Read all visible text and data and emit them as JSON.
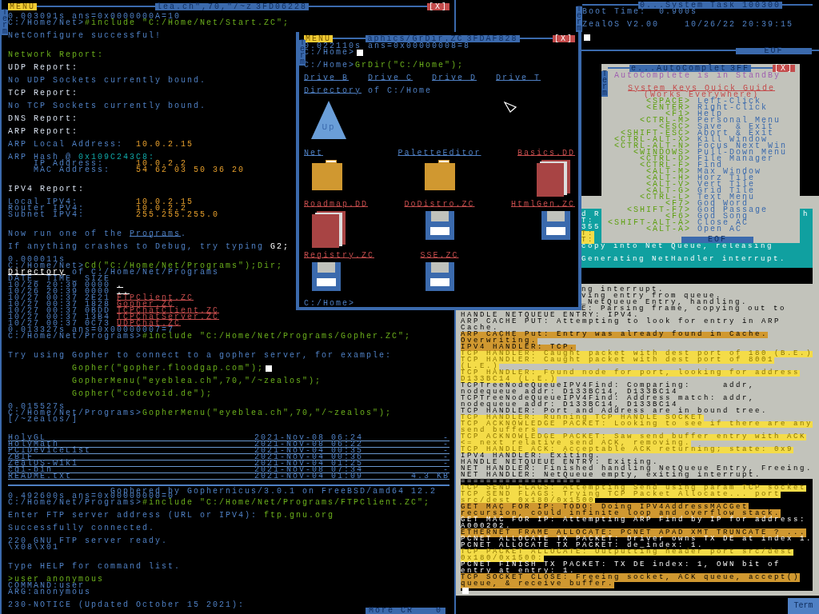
{
  "main_window": {
    "menu": "MENU",
    "title": "lea.ch\",70,\"/~z",
    "task_id": "3FD06228",
    "close": "[X]",
    "side_tab": "Term",
    "lines": [
      {
        "segments": [
          {
            "kind": "out",
            "text": "0.003091s ans=0x0000000A=10"
          }
        ]
      },
      {
        "segments": [
          {
            "kind": "out",
            "text": "C:/Home/Net>"
          },
          {
            "kind": "cmd",
            "text": "#include \"C:/Home/Net/Start.ZC\";"
          }
        ]
      },
      {
        "segments": [
          {
            "kind": "out",
            "text": "NetConfigure successful!"
          }
        ]
      },
      {
        "segments": [
          {
            "kind": "cmd",
            "text": "Network Report:"
          }
        ]
      },
      {
        "segments": [
          {
            "kind": "head",
            "text": "UDP Report:"
          }
        ]
      },
      {
        "segments": [
          {
            "kind": "out",
            "text": "No UDP Sockets currently bound."
          }
        ]
      },
      {
        "segments": [
          {
            "kind": "head",
            "text": "TCP Report:"
          }
        ]
      },
      {
        "segments": [
          {
            "kind": "out",
            "text": "No TCP Sockets currently bound."
          }
        ]
      },
      {
        "segments": [
          {
            "kind": "head",
            "text": "DNS Report:"
          }
        ]
      },
      {
        "segments": [
          {
            "kind": "head",
            "text": "ARP Report:"
          }
        ]
      },
      {
        "segments": [
          {
            "kind": "out",
            "text": "ARP Local Address:"
          },
          {
            "kind": "val",
            "text": "10.0.2.15"
          }
        ]
      },
      {
        "segments": [
          {
            "kind": "out",
            "text": "ARP Hash @ "
          },
          {
            "kind": "addr",
            "text": "0x109C243C8:"
          }
        ]
      },
      {
        "segments": [
          {
            "kind": "out",
            "text": "IP Address:"
          },
          {
            "kind": "val",
            "text": "10.0.2.2"
          }
        ]
      },
      {
        "segments": [
          {
            "kind": "out",
            "text": "MAC Address:"
          },
          {
            "kind": "val",
            "text": "54 62 03 50 36 20"
          }
        ]
      },
      {
        "segments": [
          {
            "kind": "head",
            "text": "IPV4 Report:"
          }
        ]
      },
      {
        "segments": [
          {
            "kind": "out",
            "text": "Local IPV4:"
          },
          {
            "kind": "val",
            "text": "10.0.2.15"
          }
        ]
      },
      {
        "segments": [
          {
            "kind": "out",
            "text": "Router IPV4:"
          },
          {
            "kind": "val",
            "text": "10.0.2.2"
          }
        ]
      },
      {
        "segments": [
          {
            "kind": "out",
            "text": "Subnet IPV4:"
          },
          {
            "kind": "val",
            "text": "255.255.255.0"
          }
        ]
      },
      {
        "segments": [
          {
            "kind": "out",
            "text": "Now run one of the "
          },
          {
            "kind": "link",
            "text": "Programs"
          },
          {
            "kind": "out",
            "text": "."
          }
        ]
      },
      {
        "segments": [
          {
            "kind": "out",
            "text": "If anything crashes to Debug, try typing "
          },
          {
            "kind": "hi",
            "text": "G2;"
          }
        ]
      },
      {
        "segments": [
          {
            "kind": "out",
            "text": "0.000011s"
          }
        ]
      },
      {
        "segments": [
          {
            "kind": "out",
            "text": "C:/Home/Net>"
          },
          {
            "kind": "cmd",
            "text": "Cd(\"C:/Home/Net/Programs\");Dir;"
          }
        ]
      },
      {
        "segments": [
          {
            "kind": "dir",
            "text": "Directory"
          },
          {
            "kind": "out",
            "text": " of C:/Home/Net/Programs"
          }
        ]
      },
      {
        "segments": [
          {
            "kind": "out",
            "text": "DATE_ TIME_ SIZE"
          }
        ]
      },
      {
        "segments": [
          {
            "kind": "out",
            "text": "10/26 20:39 0000 "
          },
          {
            "kind": "dir",
            "text": "."
          }
        ]
      },
      {
        "segments": [
          {
            "kind": "out",
            "text": "10/26 20:39 0000 "
          },
          {
            "kind": "dir",
            "text": ".."
          }
        ]
      },
      {
        "segments": [
          {
            "kind": "out",
            "text": "10/27 00:37 2E21 "
          },
          {
            "kind": "file",
            "text": "FTPClient.ZC"
          }
        ]
      },
      {
        "segments": [
          {
            "kind": "out",
            "text": "10/27 00:37 1828 "
          },
          {
            "kind": "file",
            "text": "Gopher.ZC"
          }
        ]
      },
      {
        "segments": [
          {
            "kind": "out",
            "text": "10/27 00:37 0BDD "
          },
          {
            "kind": "file",
            "text": "TCPChatClient.ZC"
          }
        ]
      },
      {
        "segments": [
          {
            "kind": "out",
            "text": "10/27 00:37 13B4 "
          },
          {
            "kind": "file",
            "text": "TCPChatServer.ZC"
          }
        ]
      },
      {
        "segments": [
          {
            "kind": "out",
            "text": "10/27 00:37 0C73 "
          },
          {
            "kind": "file",
            "text": "UDPChat.ZC"
          }
        ]
      },
      {
        "segments": [
          {
            "kind": "out",
            "text": "0.013327s ans=0x00000007=7"
          }
        ]
      },
      {
        "segments": [
          {
            "kind": "out",
            "text": "C:/Home/Net/Programs>"
          },
          {
            "kind": "cmd",
            "text": "#include \"C:/Home/Net/Programs/Gopher.ZC\";"
          }
        ]
      },
      {
        "segments": [
          {
            "kind": "out",
            "text": "Try using Gopher to connect to a gopher server, for example:"
          }
        ]
      },
      {
        "cursor": true,
        "segments": [
          {
            "kind": "cmd",
            "text": "Gopher(\"gopher.floodgap.com\");"
          }
        ]
      },
      {
        "segments": [
          {
            "kind": "cmd",
            "text": "GopherMenu(\"eyeblea.ch\",70,\"/~zealos\");"
          }
        ]
      },
      {
        "segments": [
          {
            "kind": "cmd",
            "text": "Gopher(\"codevoid.de\");"
          }
        ]
      },
      {
        "segments": [
          {
            "kind": "out",
            "text": "0.015527s"
          }
        ]
      },
      {
        "segments": [
          {
            "kind": "out",
            "text": "C:/Home/Net/Programs>"
          },
          {
            "kind": "cmd",
            "text": "GopherMenu(\"eyeblea.ch\",70,\"/~zealos\");"
          }
        ]
      },
      {
        "segments": [
          {
            "kind": "out",
            "text": "[/~zealos/]"
          }
        ]
      }
    ],
    "gopher_listing": {
      "rows": [
        {
          "name": "HolyGL",
          "date": "2021-Nov-08 06:24",
          "size": "-"
        },
        {
          "name": "HolyMath",
          "date": "2021-Nov-08 06:22",
          "size": "-"
        },
        {
          "name": "PCIDeviceList",
          "date": "2021-Nov-04 00:35",
          "size": "-"
        },
        {
          "name": "ZBIF",
          "date": "2021-Nov-04 00:36",
          "size": "-"
        },
        {
          "name": "ZealOS-wiki",
          "date": "2021-Nov-04 01:25",
          "size": "-"
        },
        {
          "name": "cgi-bin",
          "date": "2021-Nov-08 07:34",
          "size": "-"
        },
        {
          "name": "README.txt",
          "date": "2021-Nov-04 01:09",
          "size": "4.3 KB"
        }
      ],
      "footer": "Gophered by Gophernicus/3.0.1 on FreeBSD/amd64 12.2"
    },
    "lines_after": [
      {
        "segments": [
          {
            "kind": "out",
            "text": "0.492600s ans=0x00000000=0"
          }
        ]
      },
      {
        "segments": [
          {
            "kind": "out",
            "text": "C:/Home/Net/Programs>"
          },
          {
            "kind": "cmd",
            "text": "#include \"C:/Home/Net/Programs/FTPClient.ZC\";"
          }
        ]
      },
      {
        "segments": [
          {
            "kind": "out",
            "text": "Enter FTP server address (URL or IPV4): "
          },
          {
            "kind": "cmd",
            "text": "ftp.gnu.org"
          }
        ]
      },
      {
        "segments": [
          {
            "kind": "out",
            "text": "Successfully connected."
          }
        ]
      },
      {
        "segments": [
          {
            "kind": "out",
            "text": "220 GNU FTP server ready."
          }
        ]
      },
      {
        "segments": [
          {
            "kind": "out",
            "text": "\\x08\\x01"
          }
        ]
      },
      {
        "segments": [
          {
            "kind": "out",
            "text": "Type HELP for command list."
          }
        ]
      },
      {
        "segments": [
          {
            "kind": "cmd",
            "text": ">user anonymous"
          }
        ]
      },
      {
        "segments": [
          {
            "kind": "out",
            "text": "COMMAND:user"
          }
        ]
      },
      {
        "segments": [
          {
            "kind": "out",
            "text": "ARG:anonymous"
          }
        ]
      },
      {
        "segments": [
          {
            "kind": "out",
            "text": "230-NOTICE (Updated October 15 2021):"
          }
        ]
      }
    ],
    "status_bar": {
      "label": "More CR",
      "value": "0"
    }
  },
  "grdir_window": {
    "menu": "MENU",
    "title": "aphics/GrDir.ZC",
    "task_id": "3FDAF828",
    "close": "[X]",
    "side_tab": "Term",
    "lines": [
      {
        "segments": [
          {
            "kind": "out",
            "text": "0.022110s ans=0x00000008=8"
          }
        ]
      },
      {
        "cursor": true,
        "segments": [
          {
            "kind": "out",
            "text": "C:/Home>"
          }
        ]
      },
      {
        "segments": [
          {
            "kind": "out",
            "text": "C:/Home>"
          },
          {
            "kind": "cmd",
            "text": "GrDir(\"C:/Home\");"
          }
        ]
      }
    ],
    "drives": [
      "Drive B",
      "Drive C",
      "Drive D",
      "Drive T"
    ],
    "directory": {
      "link": "Directory",
      "path": " of C:/Home"
    },
    "up_label": "Up",
    "items": [
      {
        "kind": "folder",
        "name": "Net"
      },
      {
        "kind": "folder",
        "name": "PaletteEditor"
      },
      {
        "kind": "book",
        "name": "Basics.DD"
      },
      {
        "kind": "book",
        "name": "Roadmap.DD"
      },
      {
        "kind": "file",
        "name": "DoDistro.ZC"
      },
      {
        "kind": "file",
        "name": "HtmlGen.ZC"
      },
      {
        "kind": "file",
        "name": "Registry.ZC"
      },
      {
        "kind": "file",
        "name": "SSE.ZC"
      }
    ],
    "prompt": "C:/Home>"
  },
  "system_task_window": {
    "title": "0...System Task 100300",
    "side_tab": "Term",
    "boot_label": "Boot Time:",
    "boot_value": "0.900s",
    "version": "ZealOS V2.00",
    "date_time": "10/26/22 20:39:15",
    "footer": "EOF"
  },
  "autocomplete_window": {
    "title": "e...AutoComplet",
    "task_id": "3FF",
    "close": "[X]",
    "side_tab": "Term",
    "status": "AutoComplete is in StandBy",
    "heading": "System Keys Quick Guide",
    "subheading": "(Works Everywhere)",
    "keys": [
      {
        "key": "<SPACE>",
        "action": "Left-Click"
      },
      {
        "key": "<ENTER>",
        "action": "Right-Click"
      },
      {
        "key": "<F1>",
        "action": "Help"
      },
      {
        "key": "<CTRL-M>",
        "action": "Personal Menu"
      },
      {
        "key": "<ESC>",
        "action": "Save  & Exit"
      },
      {
        "key": "<SHIFT-ESC>",
        "action": "Abort & Exit"
      },
      {
        "key": "<CTRL-ALT-X>",
        "action": "Kill Window"
      },
      {
        "key": "<CTRL-ALT-N>",
        "action": "Focus Next Win"
      },
      {
        "key": "<WINDOWS>",
        "action": "Pull-Down Menu"
      },
      {
        "key": "<CTRL-D>",
        "action": "File Manager"
      },
      {
        "key": "<CTRL-F>",
        "action": "Find"
      },
      {
        "key": "<ALT-M>",
        "action": "Max Window"
      },
      {
        "key": "<ALT-H>",
        "action": "Horz Tile"
      },
      {
        "key": "<ALT-V>",
        "action": "Vert Tile"
      },
      {
        "key": "<ALT-G>",
        "action": "Grid Tile"
      },
      {
        "key": "<CTRL-L>",
        "action": "Text Menu"
      },
      {
        "key": "<F7>",
        "action": "God Word"
      },
      {
        "key": "<SHIFT-F7>",
        "action": "God Passage"
      },
      {
        "key": "<F6>",
        "action": "God Song"
      },
      {
        "key": "<SHIFT-ALT-A>",
        "action": "Close AC"
      },
      {
        "key": "<ALT-A>",
        "action": "Open AC"
      }
    ],
    "footer": "EOF"
  },
  "net_log_window": {
    "sections": [
      {
        "kind": "teal",
        "lines": [
          {
            "kind": "plain",
            "covered": true,
            "text": "d R",
            "trailing": "h"
          },
          {
            "kind": "plain",
            "covered": true,
            "text": "T:"
          },
          {
            "kind": "plain",
            "covered": true,
            "text": "355"
          },
          {
            "kind": "notice",
            "covered": true,
            "text": "T:"
          },
          {
            "kind": "notice",
            "covered": true,
            "text": "T:"
          },
          {
            "kind": "plain",
            "covered": true,
            "text": "copy into Net Queue, releasing"
          },
          {
            "kind": "plain",
            "covered": true,
            "text": "Generating NetHandler interrupt."
          }
        ]
      },
      {
        "kind": "grey",
        "lines": [
          {
            "kind": "plain",
            "covered": true,
            "text": "ng interrupt."
          },
          {
            "kind": "plain",
            "covered": true,
            "text": "ving entry from queue."
          },
          {
            "kind": "plain",
            "covered": true,
            "text": "_NetQueue Entry, handling."
          },
          {
            "kind": "plain",
            "covered": true,
            "text": "E: Parsing frame, copying out to"
          },
          {
            "kind": "plain",
            "text": "HANDLE NETQUEUE ENTRY: IPV4."
          },
          {
            "kind": "plain",
            "text": "ARP CACHE PUT: Attempting to look for entry in ARP"
          },
          {
            "kind": "plain",
            "text": "Cache."
          },
          {
            "kind": "alert",
            "text": "ARP CACHE Put: Entry was already found in Cache."
          },
          {
            "kind": "alert",
            "text": "Overwriting."
          },
          {
            "kind": "alert",
            "text": "IPV4 HANDLER: TCP."
          },
          {
            "kind": "notice",
            "text": "TCP HANDLER: Caught packet with dest port of 180 (B.E.)"
          },
          {
            "kind": "notice",
            "text": "TCP HANDLER: Caught packet with dest port of 8001"
          },
          {
            "kind": "notice",
            "text": "(L.E.)"
          },
          {
            "kind": "notice",
            "text": "TCP HANDLER: Found node for port, looking for address"
          },
          {
            "kind": "notice",
            "text": "D133BC14 (L.E.)"
          },
          {
            "kind": "plain",
            "text": "TCPTreeNodeQueueIPV4Find: Comparing:     addr,"
          },
          {
            "kind": "plain",
            "text": "nodequeue addr: D133BC14, D133BC14"
          },
          {
            "kind": "plain",
            "text": "TCPTreeNodeQueueIPV4Find: Address match: addr,"
          },
          {
            "kind": "plain",
            "text": "nodequeue addr: D133BC14, D133BC14"
          },
          {
            "kind": "plain",
            "text": "TCP HANDLER: Port and Address are in bound tree."
          },
          {
            "kind": "notice",
            "text": "TCP HANDLER: Running TCP HANDLE SOCKET"
          },
          {
            "kind": "notice",
            "text": "TCP ACKNOWLEDGE PACKET: Looking to see if there are any"
          },
          {
            "kind": "notice",
            "text": "send buffers"
          },
          {
            "kind": "notice",
            "text": "TCP ACKNOWLEDGE PACKET: Saw send buffer entry with ACK"
          },
          {
            "kind": "notice",
            "text": "<= next relative send ACK, removing."
          },
          {
            "kind": "notice",
            "text": "TCP HANDLE ACK: Acceptable ACK returning; state: 0x9"
          },
          {
            "kind": "plain",
            "text": "IPV4 HANDLER: Exiting."
          },
          {
            "kind": "plain",
            "text": "HANDLE NETQUEUE ENTRY: Exiting."
          },
          {
            "kind": "plain",
            "text": "NET HANDLER: Finished handling NetQueue Entry, Freeing."
          },
          {
            "kind": "plain",
            "text": "NET HANDLER: NetQueue empty, exiting interrupt."
          }
        ]
      },
      {
        "kind": "black",
        "lines": [
          {
            "kind": "dark",
            "text": "==================="
          },
          {
            "kind": "notice",
            "text": "TCP SEND FLAGS: Attempting Send using param TCP socket"
          },
          {
            "kind": "notice",
            "text": "TCP SEND FLAGS: Trying TCP Packet Allocate... port"
          },
          {
            "kind": "notice",
            "text": "src/dest 0x180/0x1500"
          },
          {
            "kind": "alert",
            "text": "GET MAC FOR IP: TODO: Doing IPV4AddressMACGet"
          },
          {
            "kind": "alert",
            "text": "recursion, could infinite loop and overflow stack."
          },
          {
            "kind": "dark",
            "text": "GET MAC FOR IP: Attempting ARP Find by IP for address:"
          },
          {
            "kind": "dark",
            "text": "A000202."
          },
          {
            "kind": "alert",
            "text": "ETHERNET FRAME ALLOCATE: PCNET APAD XMT TRUNCATE ? ..."
          },
          {
            "kind": "dark",
            "text": "PCNET ALLOCATE TX PACKET: Driver owns TX DE at index 1."
          },
          {
            "kind": "dark",
            "text": "PCNET ALLOCATE TX PACKET: de_index: 1."
          },
          {
            "kind": "notice",
            "text": "TCP PACKET ALLOCATE: Outputting header port src/dest"
          },
          {
            "kind": "notice",
            "text": "0x180/0x1500:"
          },
          {
            "kind": "dark",
            "text": "PCNET FINISH TX PACKET: TX DE index: 1, OWN bit of"
          },
          {
            "kind": "dark",
            "text": "entry at entry: 1."
          },
          {
            "kind": "alert",
            "text": "TCP SOCKET CLOSE: Freeing socket, ACK queue, accept()"
          },
          {
            "kind": "alert",
            "text": "queue, & receive buffer."
          }
        ]
      }
    ],
    "cursor": true
  },
  "taskbar_tab": "Term"
}
